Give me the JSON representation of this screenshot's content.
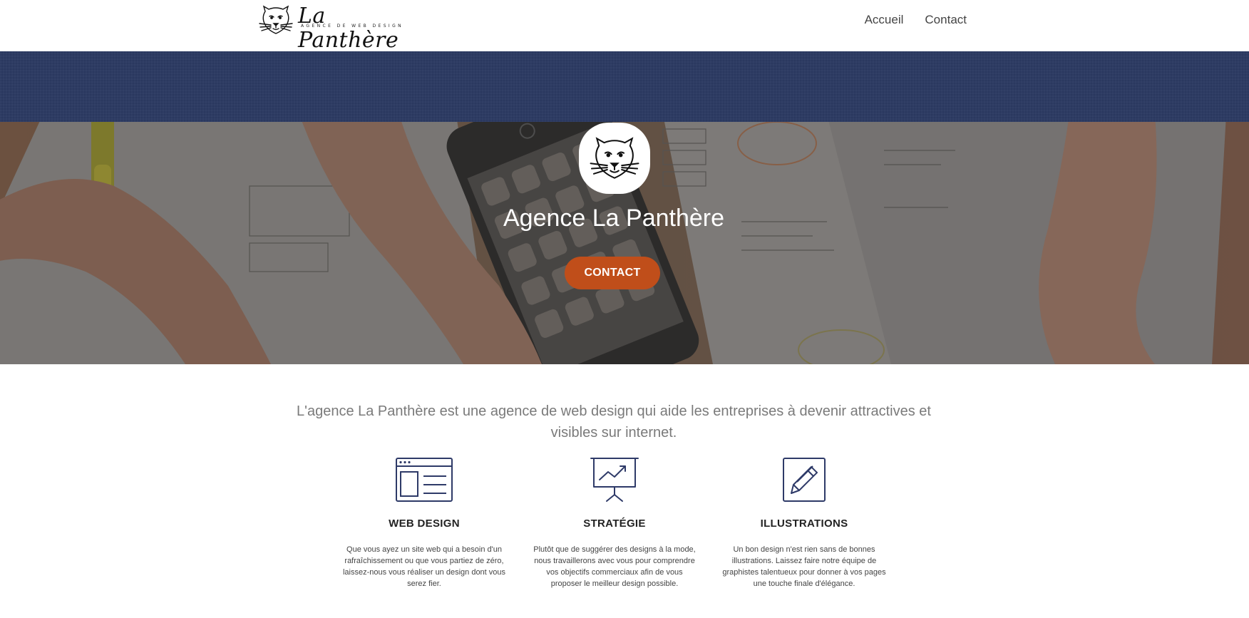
{
  "header": {
    "logo_title": "La Panthère",
    "logo_subtitle": "Agence de web design",
    "nav": [
      "Accueil",
      "Contact"
    ]
  },
  "hero": {
    "title": "Agence La Panthère",
    "cta_label": "CONTACT"
  },
  "intro": {
    "text": "L'agence La Panthère est une agence de web design qui aide les entreprises à devenir attractives et visibles sur internet."
  },
  "services": [
    {
      "icon": "web-design-icon",
      "title": "WEB DESIGN",
      "text": "Que vous ayez un site web qui a besoin d'un rafraîchissement ou que vous partiez de zéro, laissez-nous vous réaliser un design dont vous serez fier."
    },
    {
      "icon": "strategy-chart-icon",
      "title": "STRATÉGIE",
      "text": "Plutôt que de suggérer des designs à la mode, nous travaillerons avec vous pour comprendre vos objectifs commerciaux afin de vous proposer le meilleur design possible."
    },
    {
      "icon": "pencil-icon",
      "title": "ILLUSTRATIONS",
      "text": "Un bon design n'est rien sans de bonnes illustrations. Laissez faire notre équipe de graphistes talentueux pour donner à vos pages une touche finale d'élégance."
    }
  ],
  "colors": {
    "band": "#2c3a63",
    "cta": "#c04e1a",
    "icon_stroke": "#2e3a68"
  }
}
